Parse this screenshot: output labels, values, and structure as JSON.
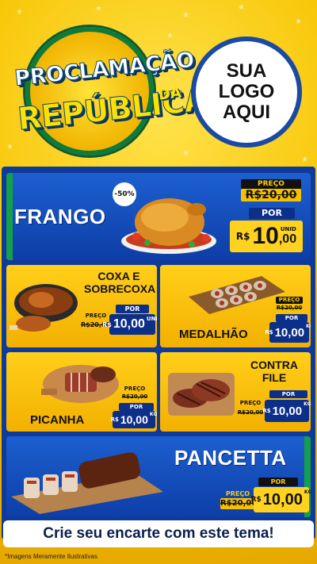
{
  "header": {
    "title_line1": "PROCLAMAÇÃO",
    "title_line2": "REPÚBLICA",
    "title_da": "DA",
    "logo_lines": [
      "SUA",
      "LOGO",
      "AQUI"
    ]
  },
  "labels": {
    "preco": "PREÇO",
    "por": "POR",
    "currency": "R$"
  },
  "products": {
    "frango": {
      "name": "FRANGO",
      "discount": "-50%",
      "old_price": "R$20,00",
      "price_int": "10",
      "price_dec": ",00",
      "unit": "UNID"
    },
    "coxa": {
      "name_line1": "COXA E",
      "name_line2": "SOBRECOXA",
      "old_price": "R$20,00",
      "price": "10,00",
      "unit": "UNID"
    },
    "medalhao": {
      "name": "MEDALHÃO",
      "old_price": "R$20,00",
      "price": "10,00",
      "unit": "KG"
    },
    "picanha": {
      "name": "PICANHA",
      "old_price": "R$20,00",
      "price": "10,00",
      "unit": "KG"
    },
    "contrafile": {
      "name_line1": "CONTRA",
      "name_line2": "FILE",
      "old_price": "R$20,00",
      "price": "10,00",
      "unit": "KG"
    },
    "pancetta": {
      "name": "PANCETTA",
      "old_price": "R$20,00",
      "price": "10,00",
      "unit": "KG"
    }
  },
  "footer": {
    "cta": "Crie seu encarte com este tema!",
    "disclaimer": "*Imagens Meramente Ilustrativas"
  },
  "colors": {
    "yellow": "#f7c300",
    "blue": "#0e3a9b",
    "green": "#14a04a"
  }
}
